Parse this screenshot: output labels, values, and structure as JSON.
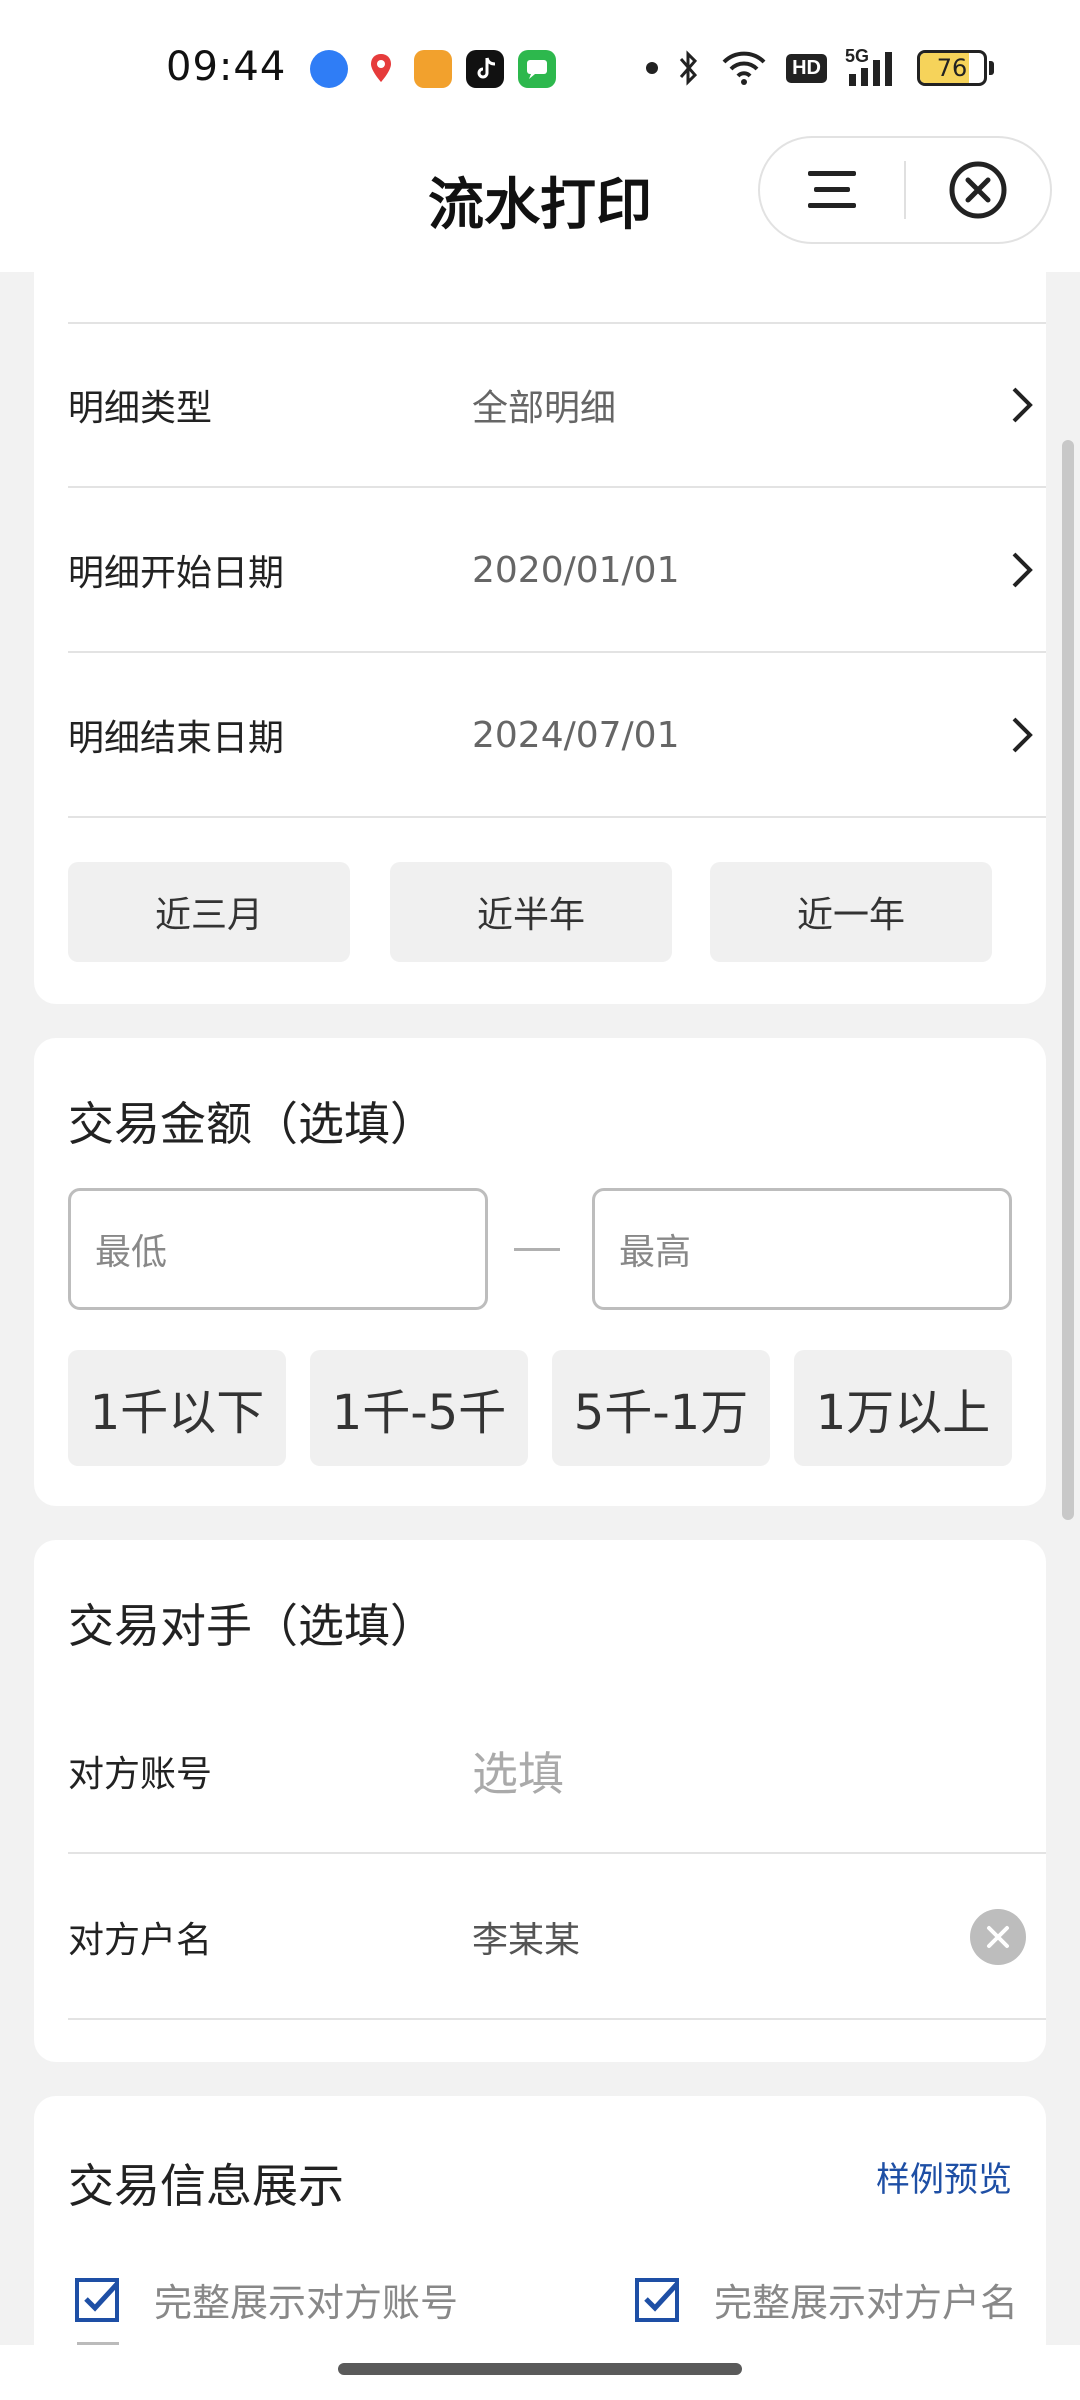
{
  "status": {
    "time": "09:44",
    "network": "5G",
    "hd": "HD",
    "battery": "76"
  },
  "nav": {
    "title": "流水打印"
  },
  "detail": {
    "type_label": "明细类型",
    "type_value": "全部明细",
    "start_label": "明细开始日期",
    "start_value": "2020/01/01",
    "end_label": "明细结束日期",
    "end_value": "2024/07/01",
    "quick_ranges": [
      "近三月",
      "近半年",
      "近一年"
    ]
  },
  "amount": {
    "title": "交易金额（选填）",
    "min_placeholder": "最低",
    "max_placeholder": "最高",
    "ranges": [
      "1千以下",
      "1千-5千",
      "5千-1万",
      "1万以上"
    ]
  },
  "counterparty": {
    "title": "交易对手（选填）",
    "account_label": "对方账号",
    "account_placeholder": "选填",
    "name_label": "对方户名",
    "name_value": "李某某"
  },
  "display": {
    "title": "交易信息展示",
    "preview_link": "样例预览",
    "options": [
      "完整展示对方账号",
      "完整展示对方户名"
    ]
  },
  "colors": {
    "accent": "#1e4fa5",
    "checkbox": "#1e4fa5"
  }
}
